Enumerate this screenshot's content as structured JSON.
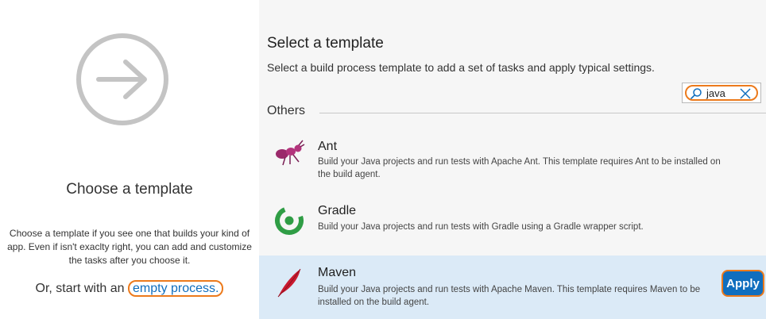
{
  "left_panel": {
    "title": "Choose a template",
    "description": "Choose a template if you see one that builds your kind of app. Even if isn't exaclty right, you can add and customize the tasks after you choose it.",
    "start_prefix": "Or, start with an ",
    "empty_process_link": "empty process."
  },
  "right_panel": {
    "title": "Select a template",
    "subtitle": "Select a build process template to add a set of tasks and apply typical settings.",
    "search": {
      "value": "java"
    },
    "section_label": "Others",
    "templates": [
      {
        "name": "Ant",
        "description": "Build your Java projects and run tests with Apache Ant. This template requires Ant to be installed on the build agent.",
        "icon": "ant-icon"
      },
      {
        "name": "Gradle",
        "description": "Build your Java projects and run tests with Gradle using a Gradle wrapper script.",
        "icon": "gradle-icon"
      },
      {
        "name": "Maven",
        "description": "Build your Java projects and run tests with Apache Maven. This template requires Maven to be installed on the build agent.",
        "icon": "maven-icon",
        "selected": true
      }
    ],
    "apply_label": "Apply"
  },
  "colors": {
    "accent": "#106ebe",
    "highlight": "#ec7a1c",
    "selected_row": "#dbeaf7"
  }
}
